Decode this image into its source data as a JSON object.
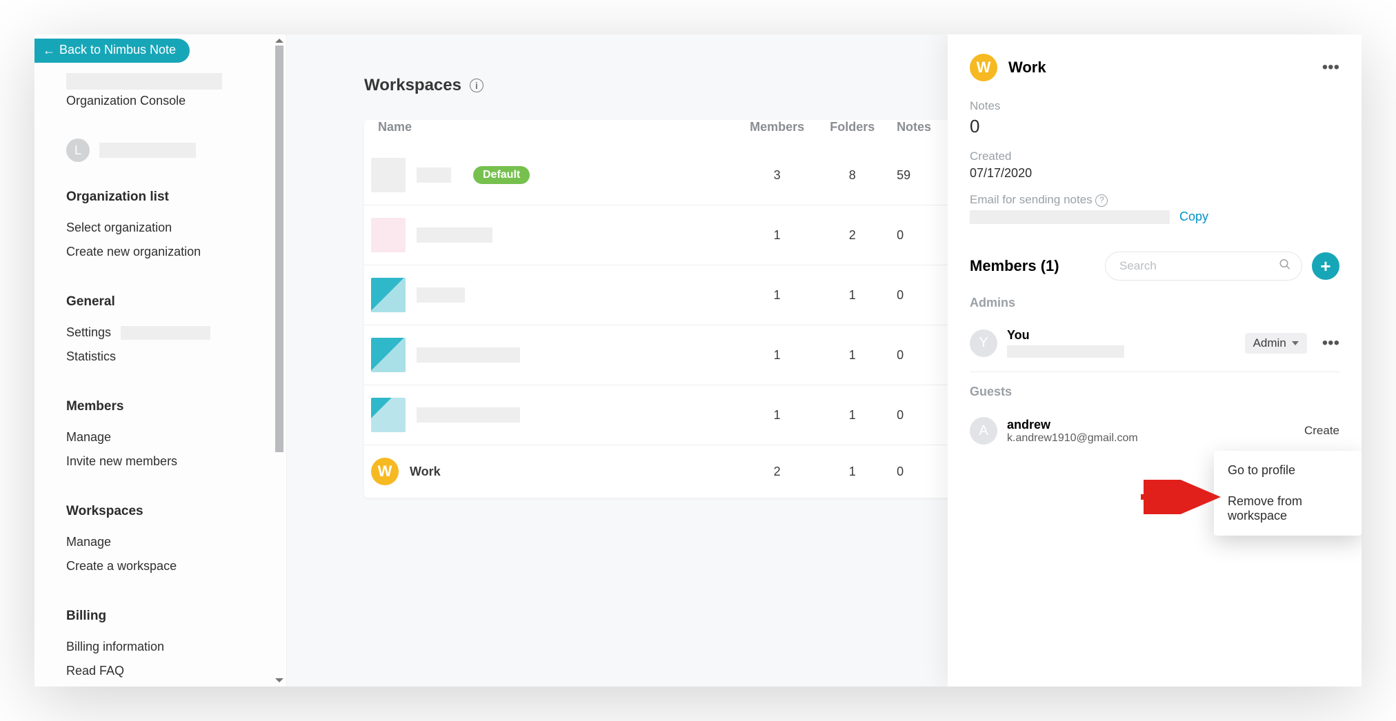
{
  "back_label": "Back to Nimbus Note",
  "sidebar": {
    "console_label": "Organization Console",
    "user_initial": "L",
    "sections": [
      {
        "heading": "Organization list",
        "items": [
          "Select organization",
          "Create new organization"
        ]
      },
      {
        "heading": "General",
        "items": [
          "Settings",
          "Statistics"
        ]
      },
      {
        "heading": "Members",
        "items": [
          "Manage",
          "Invite new members"
        ]
      },
      {
        "heading": "Workspaces",
        "items": [
          "Manage",
          "Create a workspace"
        ]
      },
      {
        "heading": "Billing",
        "items": [
          "Billing information",
          "Read FAQ"
        ]
      }
    ]
  },
  "page": {
    "title": "Workspaces",
    "columns": [
      "Name",
      "Members",
      "Folders",
      "Notes"
    ],
    "default_label": "Default",
    "rows": [
      {
        "type": "masked",
        "members": 3,
        "folders": 8,
        "notes": 59,
        "default": true
      },
      {
        "type": "masked",
        "members": 1,
        "folders": 2,
        "notes": 0
      },
      {
        "type": "masked",
        "members": 1,
        "folders": 1,
        "notes": 0
      },
      {
        "type": "masked",
        "members": 1,
        "folders": 1,
        "notes": 0
      },
      {
        "type": "masked",
        "members": 1,
        "folders": 1,
        "notes": 0
      },
      {
        "type": "work",
        "name": "Work",
        "letter": "W",
        "members": 2,
        "folders": 1,
        "notes": 0
      }
    ]
  },
  "panel": {
    "title": "Work",
    "letter": "W",
    "notes_label": "Notes",
    "notes_value": "0",
    "created_label": "Created",
    "created_value": "07/17/2020",
    "email_label": "Email for sending notes",
    "copy_label": "Copy",
    "members_heading": "Members (1)",
    "search_placeholder": "Search",
    "admins_heading": "Admins",
    "guests_heading": "Guests",
    "admin_member": {
      "letter": "Y",
      "name": "You",
      "role": "Admin"
    },
    "guest_member": {
      "letter": "A",
      "name": "andrew",
      "email": "k.andrew1910@gmail.com",
      "state": "Create"
    },
    "context_menu": [
      "Go to profile",
      "Remove from workspace"
    ]
  }
}
